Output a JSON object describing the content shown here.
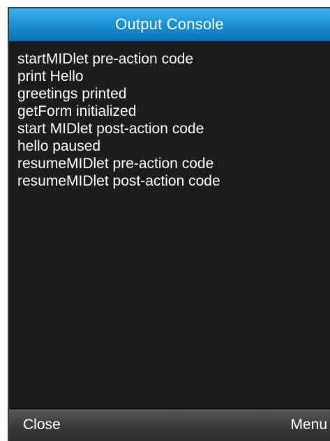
{
  "window": {
    "title": "Output Console"
  },
  "console": {
    "lines": [
      "startMIDlet pre-action code",
      "print Hello",
      "greetings printed",
      "getForm initialized",
      "start MIDlet post-action code",
      "hello paused",
      "resumeMIDlet pre-action code",
      "resumeMIDlet post-action code"
    ]
  },
  "softkeys": {
    "left_label": "Close",
    "right_label": "Menu"
  },
  "colors": {
    "titlebar_accent": "#1a8ed2",
    "background": "#1c1c1c",
    "text": "#ffffff"
  }
}
